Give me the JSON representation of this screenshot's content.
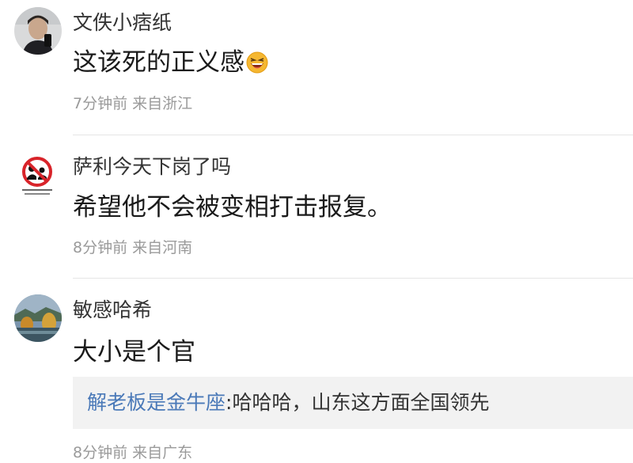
{
  "comments": [
    {
      "username": "文佚小痞纸",
      "content": "这该死的正义感",
      "emoji": "laughing-emoji",
      "time": "7分钟前",
      "location": "来自浙江"
    },
    {
      "username": "萨利今天下岗了吗",
      "content": "希望他不会被变相打击报复。",
      "time": "8分钟前",
      "location": "来自河南"
    },
    {
      "username": "敏感哈希",
      "content": "大小是个官",
      "reply": {
        "user": "解老板是金牛座",
        "separator": ":",
        "text": "哈哈哈，山东这方面全国领先"
      },
      "time": "8分钟前",
      "location": "来自广东"
    }
  ],
  "colors": {
    "link": "#4a79b8",
    "meta": "#9a9a9a",
    "divider": "#e6e6e6",
    "reply_bg": "#f2f2f2"
  }
}
